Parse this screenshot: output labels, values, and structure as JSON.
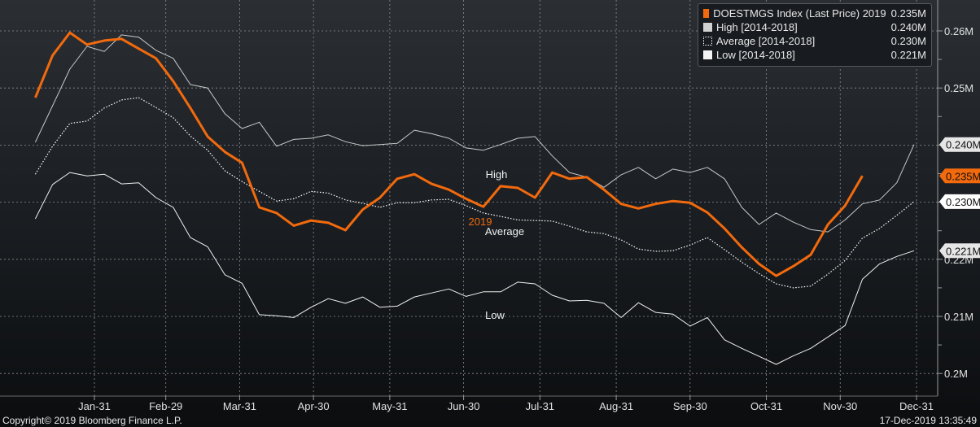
{
  "chart_data": {
    "type": "line",
    "title": "",
    "xlabel": "",
    "ylabel": "",
    "x_tick_labels": [
      "Jan-31",
      "Feb-29",
      "Mar-31",
      "Apr-30",
      "May-31",
      "Jun-30",
      "Jul-31",
      "Aug-31",
      "Sep-30",
      "Oct-31",
      "Nov-30",
      "Dec-31"
    ],
    "y_tick_labels": [
      "0.26M",
      "0.25M",
      "0.24M",
      "0.23M",
      "0.22M",
      "0.21M",
      "0.2M"
    ],
    "y_ticks": [
      0.26,
      0.25,
      0.24,
      0.23,
      0.22,
      0.21,
      0.2
    ],
    "ylim": [
      0.1965,
      0.2655
    ],
    "grid": true,
    "legend_position": "top-right",
    "dates": [
      "2019-01-07",
      "2019-01-14",
      "2019-01-21",
      "2019-01-28",
      "2019-02-04",
      "2019-02-11",
      "2019-02-18",
      "2019-02-25",
      "2019-03-04",
      "2019-03-11",
      "2019-03-18",
      "2019-03-25",
      "2019-04-01",
      "2019-04-08",
      "2019-04-15",
      "2019-04-22",
      "2019-04-29",
      "2019-05-06",
      "2019-05-13",
      "2019-05-20",
      "2019-05-27",
      "2019-06-03",
      "2019-06-10",
      "2019-06-17",
      "2019-06-24",
      "2019-07-01",
      "2019-07-08",
      "2019-07-15",
      "2019-07-22",
      "2019-07-29",
      "2019-08-05",
      "2019-08-12",
      "2019-08-19",
      "2019-08-26",
      "2019-09-02",
      "2019-09-09",
      "2019-09-16",
      "2019-09-23",
      "2019-09-30",
      "2019-10-07",
      "2019-10-14",
      "2019-10-21",
      "2019-10-28",
      "2019-11-04",
      "2019-11-11",
      "2019-11-18",
      "2019-11-25",
      "2019-12-02",
      "2019-12-09",
      "2019-12-16",
      "2019-12-23",
      "2019-12-30"
    ],
    "series": [
      {
        "name": "High [2014-2018]",
        "legend_value": "0.240M",
        "label": "High",
        "tag": "0.240M",
        "color": "#c8c8c8",
        "style": "solid",
        "values": [
          0.2405,
          0.2469,
          0.2533,
          0.2573,
          0.2564,
          0.2593,
          0.2589,
          0.2566,
          0.2552,
          0.2506,
          0.25,
          0.2455,
          0.2429,
          0.244,
          0.2398,
          0.241,
          0.2412,
          0.2418,
          0.2406,
          0.2399,
          0.2401,
          0.2403,
          0.2426,
          0.242,
          0.2412,
          0.2395,
          0.2391,
          0.2401,
          0.2412,
          0.2415,
          0.2381,
          0.2352,
          0.2344,
          0.2326,
          0.2348,
          0.2361,
          0.2341,
          0.2358,
          0.2352,
          0.2361,
          0.2341,
          0.2291,
          0.2261,
          0.2281,
          0.2265,
          0.2252,
          0.2248,
          0.2269,
          0.2297,
          0.2304,
          0.2334,
          0.2401
        ]
      },
      {
        "name": "Average [2014-2018]",
        "legend_value": "0.230M",
        "label": "Average",
        "tag": "0.230M",
        "color": "#ffffff",
        "style": "dotted",
        "values": [
          0.2349,
          0.2398,
          0.2438,
          0.2442,
          0.2465,
          0.2479,
          0.2483,
          0.2466,
          0.2448,
          0.2416,
          0.2391,
          0.2355,
          0.2336,
          0.2319,
          0.2302,
          0.2306,
          0.2319,
          0.2316,
          0.2304,
          0.2298,
          0.2291,
          0.2299,
          0.2299,
          0.2304,
          0.2305,
          0.2294,
          0.2281,
          0.2275,
          0.2269,
          0.2268,
          0.2267,
          0.2258,
          0.2248,
          0.2245,
          0.2234,
          0.2218,
          0.2214,
          0.2215,
          0.2225,
          0.2238,
          0.2217,
          0.2195,
          0.2175,
          0.2157,
          0.215,
          0.2153,
          0.2174,
          0.2198,
          0.2237,
          0.2254,
          0.2277,
          0.2301
        ]
      },
      {
        "name": "Low [2014-2018]",
        "legend_value": "0.221M",
        "label": "Low",
        "tag": "0.221M",
        "color": "#f0f0f0",
        "style": "solid",
        "values": [
          0.2271,
          0.2331,
          0.2352,
          0.2346,
          0.2349,
          0.2332,
          0.2334,
          0.2308,
          0.2291,
          0.2238,
          0.2222,
          0.2173,
          0.2158,
          0.2103,
          0.2101,
          0.2098,
          0.2116,
          0.2131,
          0.2123,
          0.2134,
          0.2116,
          0.2118,
          0.2134,
          0.2141,
          0.2148,
          0.2135,
          0.2143,
          0.2143,
          0.216,
          0.2157,
          0.2137,
          0.2127,
          0.2128,
          0.2123,
          0.2098,
          0.2124,
          0.2107,
          0.2104,
          0.2083,
          0.2098,
          0.2059,
          0.2044,
          0.203,
          0.2016,
          0.2031,
          0.2044,
          0.2064,
          0.2084,
          0.2165,
          0.2192,
          0.2205,
          0.2215
        ]
      },
      {
        "name": "DOESTMGS Index (Last Price) 2019",
        "legend_value": "0.235M",
        "label": "2019",
        "tag": "0.235M",
        "color": "#f26a0d",
        "style": "thick",
        "values": [
          0.2483,
          0.2557,
          0.2597,
          0.2576,
          0.2583,
          0.2586,
          0.2569,
          0.2552,
          0.2512,
          0.2465,
          0.2415,
          0.2388,
          0.2369,
          0.2291,
          0.2281,
          0.2259,
          0.2268,
          0.2264,
          0.2251,
          0.2287,
          0.2308,
          0.2341,
          0.2349,
          0.2332,
          0.2322,
          0.2306,
          0.2292,
          0.2328,
          0.2325,
          0.2308,
          0.2352,
          0.2341,
          0.2344,
          0.2322,
          0.2297,
          0.2289,
          0.2297,
          0.2302,
          0.2299,
          0.2282,
          0.2254,
          0.2221,
          0.2192,
          0.2171,
          0.2188,
          0.2208,
          0.2261,
          0.2294,
          0.2346
        ]
      }
    ]
  },
  "legend": [
    {
      "name": "DOESTMGS Index (Last Price) 2019",
      "value": "0.235M",
      "color": "#f26a0d"
    },
    {
      "name": "High [2014-2018]",
      "value": "0.240M",
      "color": "#d0d0d0"
    },
    {
      "name": "Average [2014-2018]",
      "value": "0.230M",
      "color": "dotted"
    },
    {
      "name": "Low [2014-2018]",
      "value": "0.221M",
      "color": "#f4f4f4"
    }
  ],
  "footer": {
    "copyright": "Copyright© 2019 Bloomberg Finance L.P.",
    "timestamp": "17-Dec-2019 13:35:49"
  }
}
